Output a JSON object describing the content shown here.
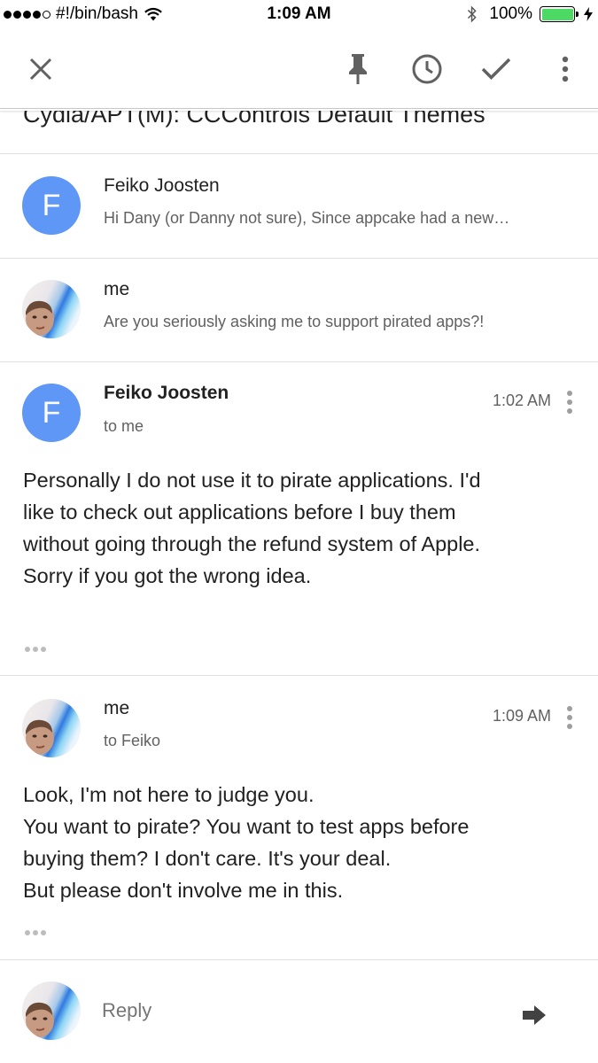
{
  "status_bar": {
    "carrier": "#!/bin/bash",
    "time": "1:09 AM",
    "battery_percent": "100%",
    "battery_color": "#4cd964",
    "icons": [
      "signal-dots",
      "wifi-icon",
      "bluetooth-icon",
      "battery-icon",
      "charging-bolt-icon"
    ]
  },
  "toolbar": {
    "icons": [
      "close-icon",
      "pin-icon",
      "snooze-clock-icon",
      "done-check-icon",
      "more-vert-icon"
    ]
  },
  "subject": "Cydia/APT(M): CCControls Default Themes",
  "thread": {
    "collapsed": [
      {
        "avatar_letter": "F",
        "sender": "Feiko Joosten",
        "snippet": "Hi Dany (or Danny not sure), Since appcake had a new…"
      },
      {
        "avatar_letter": "",
        "sender": "me",
        "snippet": "Are you seriously asking me to support pirated apps?!"
      }
    ],
    "expanded": [
      {
        "avatar_letter": "F",
        "sender": "Feiko Joosten",
        "recipient": "to me",
        "time": "1:02 AM",
        "body": [
          "Personally I do not use it to pirate applications. I'd",
          "like to check out applications before I buy them",
          "without going through the refund system of Apple.",
          "Sorry if you got the wrong idea."
        ]
      },
      {
        "avatar_letter": "",
        "sender": "me",
        "recipient": "to Feiko",
        "time": "1:09 AM",
        "body": [
          "Look, I'm not here to judge you.",
          "You want to pirate? You want to test apps before",
          "buying them? I don't care. It's your deal.",
          "But please don't involve me in this."
        ]
      }
    ]
  },
  "reply": {
    "label": "Reply"
  },
  "colors": {
    "avatar_blue": "#5e97f6",
    "divider": "#e0e0e0",
    "icon_gray": "#616161"
  }
}
